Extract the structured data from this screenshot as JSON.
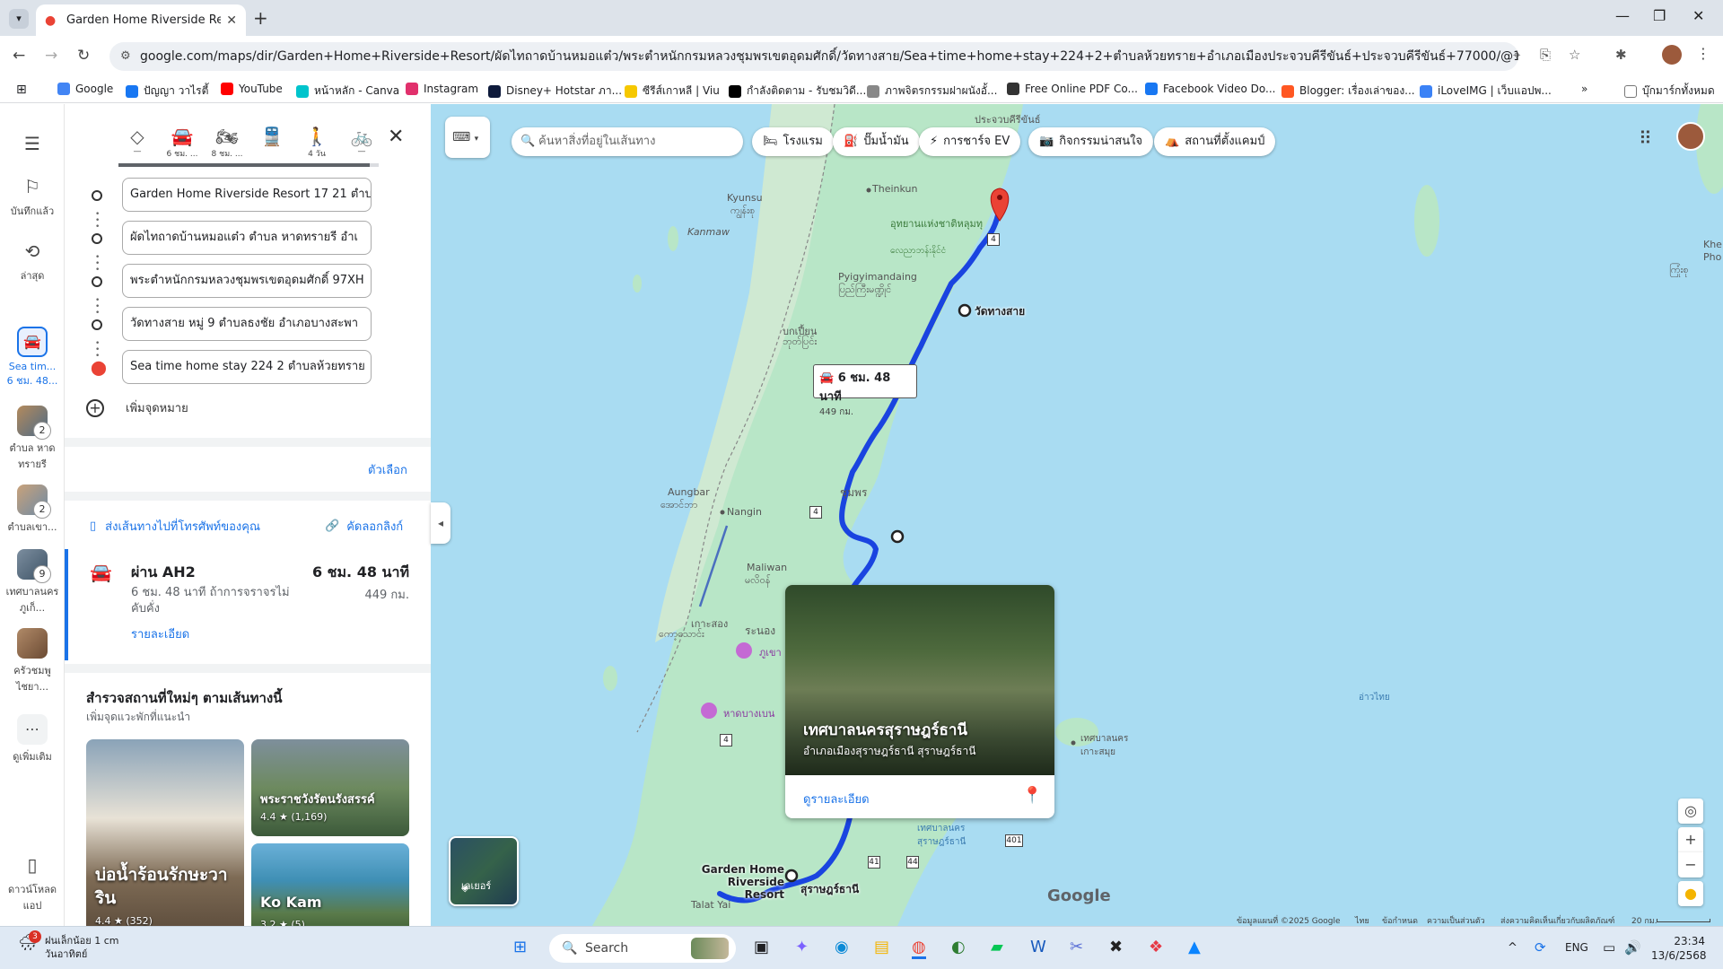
{
  "browser": {
    "tab_title": "Garden Home Riverside Resort",
    "url": "google.com/maps/dir/Garden+Home+Riverside+Resort/ผัดไทถาดบ้านหมอแต๋ว/พระตำหนักกรมหลวงชุมพรเขตอุดมศักดิ์/วัดทางสาย/Sea+time+home+stay+224+2+ตำบลห้วยทราย+อำเภอเมืองประจวบคีรีขันธ์+ประจวบคีรีขันธ์+77000/@10.4863828,99.1245644,8.5z/...",
    "bookmarks": [
      {
        "label": "Google",
        "color": "#4285f4",
        "icon": "google-icon"
      },
      {
        "label": "ปัญญา วาไรตี้",
        "color": "#1877f2",
        "icon": "facebook-icon"
      },
      {
        "label": "YouTube",
        "color": "#ff0000",
        "icon": "youtube-icon"
      },
      {
        "label": "หน้าหลัก - Canva",
        "color": "#00c4cc",
        "icon": "canva-icon"
      },
      {
        "label": "Instagram",
        "color": "#e1306c",
        "icon": "instagram-icon"
      },
      {
        "label": "Disney+ Hotstar ภา...",
        "color": "#0e1a3b",
        "icon": "hotstar-icon"
      },
      {
        "label": "ซีรีส์เกาหลี | Viu",
        "color": "#f6c800",
        "icon": "viu-icon"
      },
      {
        "label": "กำลังติดตาม - รับชมวิดี...",
        "color": "#000000",
        "icon": "tiktok-icon"
      },
      {
        "label": "ภาพจิตรกรรมฝาผนังอั้...",
        "color": "#888888",
        "icon": "web-icon"
      },
      {
        "label": "Free Online PDF Co...",
        "color": "#333333",
        "icon": "pdf-icon"
      },
      {
        "label": "Facebook Video Do...",
        "color": "#1877f2",
        "icon": "download-icon"
      },
      {
        "label": "Blogger: เรื่องเล่าของ...",
        "color": "#ff5722",
        "icon": "blogger-icon"
      },
      {
        "label": "iLoveIMG | เว็บแอปพ...",
        "color": "#3b82f6",
        "icon": "iloveimg-icon"
      }
    ],
    "all_bookmarks": "บุ๊กมาร์กทั้งหมด"
  },
  "rail": {
    "saved": "บันทึกแล้ว",
    "recent": "ล่าสุด",
    "current": "Sea tim... 6 ชม. 48...",
    "items": [
      {
        "label": "ตำบล หาดทรายรี",
        "badge": "2"
      },
      {
        "label": "ตำบลเขา...",
        "badge": "2"
      },
      {
        "label": "เทศบาลนครภูเก็...",
        "badge": "9"
      },
      {
        "label": "ครัวชมพู ไชยา...",
        "badge": ""
      }
    ],
    "more": "ดูเพิ่มเติม",
    "download": "ดาวน์โหลดแอป"
  },
  "modes": [
    {
      "label": "—",
      "icon": "best-icon"
    },
    {
      "label": "6 ชม. ...",
      "icon": "car-icon"
    },
    {
      "label": "8 ชม. ...",
      "icon": "motorcycle-icon"
    },
    {
      "label": "",
      "icon": "transit-icon"
    },
    {
      "label": "4 วัน",
      "icon": "walk-icon"
    },
    {
      "label": "—",
      "icon": "bike-icon"
    }
  ],
  "waypoints": [
    "Garden Home Riverside Resort 17 21 ตำบล",
    "ผัดไทถาดบ้านหมอแต๋ว ตำบล หาดทรายรี อำเ",
    "พระตำหนักกรมหลวงชุมพรเขตอุดมศักดิ์ 97XH",
    "วัดทางสาย หมู่ 9 ตำบลธงชัย อำเภอบางสะพา",
    "Sea time home stay 224 2 ตำบลห้วยทราย"
  ],
  "add_destination": "เพิ่มจุดหมาย",
  "options": "ตัวเลือก",
  "send_to_phone": "ส่งเส้นทางไปที่โทรศัพท์ของคุณ",
  "copy_link": "คัดลอกลิงก์",
  "route": {
    "via": "ผ่าน AH2",
    "duration": "6 ชม. 48 นาที",
    "desc": "6 ชม. 48 นาที ถ้าการจราจรไม่คับคั่ง",
    "distance": "449 กม.",
    "details": "รายละเอียด"
  },
  "explore": {
    "title": "สำรวจสถานที่ใหม่ๆ ตามเส้นทางนี้",
    "subtitle": "เพิ่มจุดแวะพักที่แนะนำ",
    "cards": [
      {
        "name": "บ่อน้ำร้อนรักษะวาริน",
        "rating": "4.4 ★ (352)"
      },
      {
        "name": "พระราชวังรัตนรังสรรค์",
        "rating": "4.4 ★ (1,169)"
      },
      {
        "name": "Ko Kam",
        "rating": "3.2 ★ (5)"
      }
    ]
  },
  "map": {
    "search_placeholder": "ค้นหาสิ่งที่อยู่ในเส้นทาง",
    "chips": [
      {
        "label": "โรงแรม",
        "icon": "hotel-icon"
      },
      {
        "label": "ปั๊มน้ำมัน",
        "icon": "gas-icon"
      },
      {
        "label": "การชาร์จ EV",
        "icon": "ev-icon"
      },
      {
        "label": "กิจกรรมน่าสนใจ",
        "icon": "camera-icon"
      },
      {
        "label": "สถานที่ตั้งแคมป์",
        "icon": "camp-icon"
      }
    ],
    "route_box": {
      "time": "6 ชม. 48 นาที",
      "dist": "449 กม."
    },
    "labels": {
      "prachuap": "ประจวบคีรีขันธ์",
      "theinkun": "Theinkun",
      "kyunsu": "Kyunsu",
      "kyunsu_my": "ကျွန်းစု",
      "kanmaw": "Kanmaw",
      "park": "อุทยานแห่งชาติหลุมทุ",
      "park2": "လေညာဘန်းနိုင်ငံ",
      "pyigyimandaing": "Pyigyimandaing",
      "pyigyi_my": "ပြည်ကြီးမဏ္ဍိုင်",
      "watthangsai": "วัดทางสาย",
      "bokpyin": "ဘုတ်ပြင်း",
      "bokpyin_th": "บกเปี้ยน",
      "aungbar": "Aungbar",
      "aungbar_my": "အောင်ဘာ",
      "nangin": "Nangin",
      "chumphon": "ชุมพร",
      "maliwan": "Maliwan",
      "maliwan_my": "မလိဝန်",
      "kosong": "เกาะสอง",
      "kosong_my": "ကော့သောင်း",
      "ranong": "ระนอง",
      "phukhao": "ภูเขา",
      "hatbangben": "หาดบางเบน",
      "gulf": "อ่าวไทย",
      "kosamui": "เทศบาลนครเกาะสมุย",
      "suratcity": "เทศบาลนครสุราษฎร์ธานี",
      "garden": "Garden Home Riverside Resort",
      "surat": "สุราษฎร์ธานี",
      "talatyai": "Talat Yai",
      "khe": "Khe",
      "pho": "Pho",
      "right_my": "ကြုံးစု"
    },
    "shields": [
      "4",
      "4",
      "4",
      "4",
      "41",
      "44",
      "401"
    ],
    "place_card": {
      "name": "เทศบาลนครสุราษฎร์ธานี",
      "address": "อำเภอเมืองสุราษฎร์ธานี สุราษฎร์ธานี",
      "details": "ดูรายละเอียด"
    },
    "layers": "เลเยอร์",
    "google": "Google",
    "footer": [
      "ข้อมูลแผนที่ ©2025 Google",
      "ไทย",
      "ข้อกำหนด",
      "ความเป็นส่วนตัว",
      "ส่งความคิดเห็นเกี่ยวกับผลิตภัณฑ์",
      "20 กม."
    ]
  },
  "taskbar": {
    "weather_temp": "ฝนเล็กน้อย 1 cm",
    "weather_day": "วันอาทิตย์",
    "weather_badge": "3",
    "search": "Search",
    "lang": "ENG",
    "time": "23:34",
    "date": "13/6/2568"
  }
}
